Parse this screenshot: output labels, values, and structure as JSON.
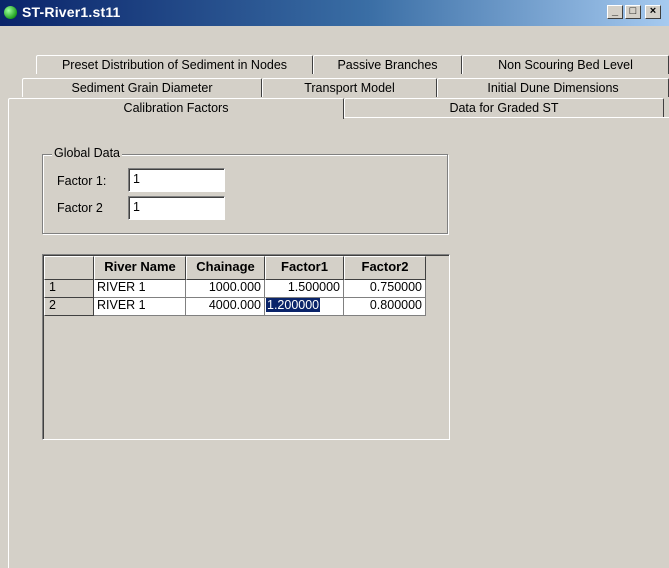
{
  "window": {
    "title": "ST-River1.st11",
    "minimize_label": "_",
    "maximize_label": "□",
    "close_label": "×"
  },
  "tabs": {
    "row1": [
      "Preset Distribution of Sediment in Nodes",
      "Passive Branches",
      "Non Scouring Bed Level"
    ],
    "row2": [
      "Sediment Grain Diameter",
      "Transport Model",
      "Initial Dune Dimensions"
    ],
    "row3": [
      "Calibration Factors",
      "Data for Graded ST"
    ],
    "active": "Calibration Factors"
  },
  "global_data": {
    "legend": "Global Data",
    "factor1_label": "Factor 1:",
    "factor1_value": "1",
    "factor2_label": "Factor 2",
    "factor2_value": "1"
  },
  "table": {
    "columns": [
      "",
      "River Name",
      "Chainage",
      "Factor1",
      "Factor2"
    ],
    "rows": [
      {
        "index": "1",
        "river": "RIVER 1",
        "chainage": "1000.000",
        "factor1": "1.500000",
        "factor2": "0.750000"
      },
      {
        "index": "2",
        "river": "RIVER 1",
        "chainage": "4000.000",
        "factor1": "1.200000",
        "factor2": "0.800000"
      }
    ],
    "selected_cell": "rows.1.factor1"
  }
}
